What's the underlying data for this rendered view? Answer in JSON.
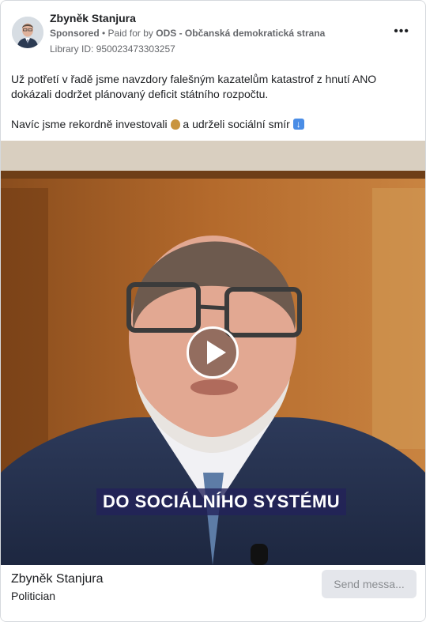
{
  "post": {
    "author": "Zbyněk Stanjura",
    "sponsored_label": "Sponsored",
    "paid_for_prefix": " • Paid for by ",
    "paid_by": "ODS - Občanská demokratická strana",
    "library_id": "Library ID: 950023473303257",
    "more_icon": "more-horizontal-icon",
    "text_line1": "Už potřetí v řadě jsme navzdory falešným kazatelům katastrof z hnutí ANO dokázali dodržet plánovaný deficit státního rozpočtu.",
    "text_line2_before": "Navíc jsme rekordně investovali ",
    "text_line2_middle": " a udrželi sociální smír",
    "emoji_1": "money-bag-icon",
    "emoji_2": "down-arrow-icon"
  },
  "video": {
    "caption": "DO SOCIÁLNÍHO SYSTÉMU",
    "play_icon": "play-icon"
  },
  "footer": {
    "page_name": "Zbyněk Stanjura",
    "category": "Politician",
    "send_button": "Send messa..."
  },
  "colors": {
    "meta_gray": "#65676b",
    "caption_bg": "#23215a",
    "button_bg": "#e4e6eb"
  }
}
